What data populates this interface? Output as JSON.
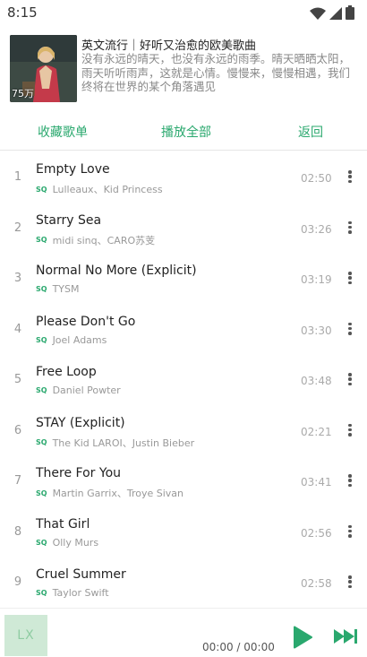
{
  "status_bar": {
    "time": "8:15"
  },
  "playlist": {
    "title": "英文流行｜好听又治愈的欧美歌曲",
    "description": "没有永远的晴天，也没有永远的雨季。晴天晒晒太阳，雨天听听雨声，这就是心情。慢慢来，慢慢相遇，我们终将在世界的某个角落遇见",
    "play_count": "75万"
  },
  "actions": {
    "favorite": "收藏歌单",
    "play_all": "播放全部",
    "back": "返回"
  },
  "songs": [
    {
      "index": "1",
      "title": "Empty Love",
      "quality": "SQ",
      "artist": "Lulleaux、Kid Princess",
      "duration": "02:50"
    },
    {
      "index": "2",
      "title": "Starry Sea",
      "quality": "SQ",
      "artist": "midi sinq、CARO苏芰",
      "duration": "03:26"
    },
    {
      "index": "3",
      "title": "Normal No More (Explicit)",
      "quality": "SQ",
      "artist": "TYSM",
      "duration": "03:19"
    },
    {
      "index": "4",
      "title": "Please Don't Go",
      "quality": "SQ",
      "artist": "Joel Adams",
      "duration": "03:30"
    },
    {
      "index": "5",
      "title": "Free Loop",
      "quality": "SQ",
      "artist": "Daniel Powter",
      "duration": "03:48"
    },
    {
      "index": "6",
      "title": "STAY (Explicit)",
      "quality": "SQ",
      "artist": "The Kid LAROI、Justin Bieber",
      "duration": "02:21"
    },
    {
      "index": "7",
      "title": "There For You",
      "quality": "SQ",
      "artist": "Martin Garrix、Troye Sivan",
      "duration": "03:41"
    },
    {
      "index": "8",
      "title": "That Girl",
      "quality": "SQ",
      "artist": "Olly Murs",
      "duration": "02:56"
    },
    {
      "index": "9",
      "title": "Cruel Summer",
      "quality": "SQ",
      "artist": "Taylor Swift",
      "duration": "02:58"
    }
  ],
  "player": {
    "cover_text": "LX",
    "time": "00:00 / 00:00"
  },
  "colors": {
    "accent": "#2aa86e",
    "text": "#222222",
    "muted": "#999999"
  },
  "icons": {
    "wifi": "wifi-icon",
    "signal": "signal-icon",
    "battery": "battery-icon",
    "more": "more-vert-icon",
    "play": "play-icon",
    "next": "skip-next-icon"
  }
}
